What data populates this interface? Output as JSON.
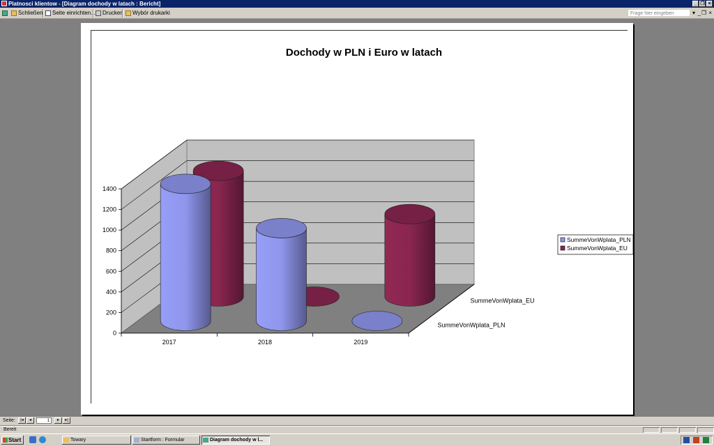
{
  "window": {
    "title": "Platnosci klientow - [Diagram dochody w latach : Bericht]"
  },
  "toolbar": {
    "close_label": "Schließen",
    "page_setup_label": "Seite einrichten...",
    "print_label": "Drucken",
    "printer_select_label": "Wybór drukarki",
    "help_placeholder": "Frage hier eingeben"
  },
  "chart_data": {
    "type": "bar",
    "subtype": "3d-cylinder",
    "title": "Dochody w PLN i Euro w latach",
    "categories": [
      "2017",
      "2018",
      "2019"
    ],
    "series": [
      {
        "name": "SummeVonWplata_PLN",
        "values": [
          1330,
          900,
          0
        ],
        "color": "#8f96ec"
      },
      {
        "name": "SummeVonWplata_EU",
        "values": [
          1220,
          0,
          800
        ],
        "color": "#8a2650"
      }
    ],
    "ylim": [
      0,
      1400
    ],
    "yticks": [
      "0",
      "200",
      "400",
      "600",
      "800",
      "1000",
      "1200",
      "1400"
    ],
    "depth_labels": [
      "SummeVonWplata_PLN",
      "SummeVonWplata_EU"
    ],
    "legend": {
      "placement": "right",
      "entries": [
        "SummeVonWplata_PLN",
        "SummeVonWplata_EU"
      ]
    },
    "grid": true
  },
  "nav": {
    "page_label": "Seite:",
    "page_number": "1"
  },
  "status": {
    "text": "Bereit"
  },
  "taskbar": {
    "start_label": "Start",
    "tasks": [
      {
        "label": "Towary"
      },
      {
        "label": "Startform : Formular"
      },
      {
        "label": "Diagram dochody w l..."
      }
    ]
  }
}
